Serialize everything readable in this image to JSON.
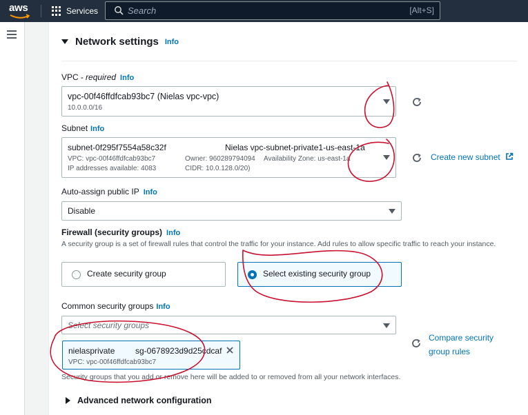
{
  "topbar": {
    "logo_text": "aws",
    "services_label": "Services",
    "search_placeholder": "Search",
    "search_shortcut": "[Alt+S]"
  },
  "section": {
    "title": "Network settings",
    "info": "Info"
  },
  "vpc": {
    "label": "VPC",
    "required": " - required",
    "info": "Info",
    "value": "vpc-00f46ffdfcab93bc7 (Nielas vpc-vpc)",
    "cidr": "10.0.0.0/16"
  },
  "subnet": {
    "label": "Subnet",
    "info": "Info",
    "id": "subnet-0f295f7554a58c32f",
    "name": "Nielas vpc-subnet-private1-us-east-1a",
    "vpc_line": "VPC: vpc-00f46ffdfcab93bc7",
    "owner_line": "Owner: 960289794094",
    "az_line": "Availability Zone: us-east-1a",
    "ips_line": "IP addresses available: 4083",
    "cidr_line": "CIDR: 10.0.128.0/20)",
    "create_link": "Create new subnet"
  },
  "public_ip": {
    "label": "Auto-assign public IP",
    "info": "Info",
    "value": "Disable"
  },
  "firewall": {
    "label": "Firewall (security groups)",
    "info": "Info",
    "description": "A security group is a set of firewall rules that control the traffic for your instance. Add rules to allow specific traffic to reach your instance.",
    "option_create": "Create security group",
    "option_select": "Select existing security group"
  },
  "common_sg": {
    "label": "Common security groups",
    "info": "Info",
    "placeholder": "Select security groups",
    "compare_link_line1": "Compare security",
    "compare_link_line2": "group rules",
    "token_name": "nielasprivate",
    "token_id": "sg-0678923d9d25cdcaf",
    "token_vpc": "VPC: vpc-00f46ffdfcab93bc7",
    "footnote": "Security groups that you add or remove here will be added to or removed from all your network interfaces."
  },
  "advanced": {
    "label": "Advanced network configuration"
  },
  "colors": {
    "annotation_red": "#c8102e",
    "link_blue": "#0073bb",
    "topbar": "#232f3e"
  }
}
